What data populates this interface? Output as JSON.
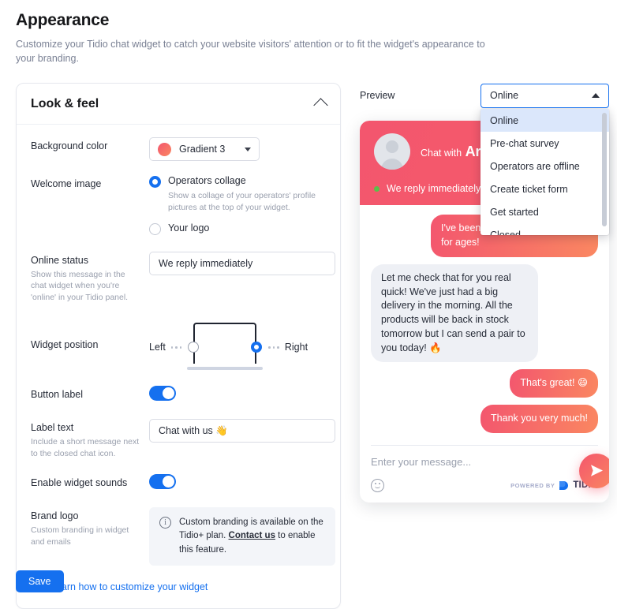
{
  "page": {
    "title": "Appearance",
    "subtitle": "Customize your Tidio chat widget to catch your website visitors' attention or to fit the widget's appearance to your branding."
  },
  "colors": {
    "accent_blue": "#1570ef",
    "gradient_start": "#f3566e",
    "gradient_end": "#fa8761",
    "online_dot": "#5bbf4a"
  },
  "look_feel": {
    "title": "Look & feel",
    "collapse_icon": "chevron-up-icon",
    "background_color": {
      "label": "Background color",
      "value": "Gradient 3",
      "swatch": "gradient-swatch"
    },
    "welcome_image": {
      "label": "Welcome image",
      "options": [
        {
          "label": "Operators collage",
          "description": "Show a collage of your operators' profile pictures at the top of your widget.",
          "selected": true
        },
        {
          "label": "Your logo",
          "description": "",
          "selected": false
        }
      ]
    },
    "online_status": {
      "label": "Online status",
      "sublabel": "Show this message in the chat widget when you're 'online' in your Tidio panel.",
      "value": "We reply immediately",
      "placeholder": "We reply immediately"
    },
    "widget_position": {
      "label": "Widget position",
      "left_label": "Left",
      "right_label": "Right",
      "selected": "Right"
    },
    "button_label": {
      "label": "Button label",
      "enabled": true
    },
    "label_text": {
      "label": "Label text",
      "sublabel": "Include a short message next to the closed chat icon.",
      "value": "Chat with us 👋",
      "placeholder": "Chat with us"
    },
    "widget_sounds": {
      "label": "Enable widget sounds",
      "enabled": true
    },
    "brand_logo": {
      "label": "Brand logo",
      "sublabel": "Custom branding in widget and emails",
      "info_icon": "info-icon",
      "info_text_before": "Custom branding is available on the Tidio+ plan. ",
      "info_link": "Contact us",
      "info_text_after": " to enable this feature."
    },
    "learn_link": {
      "icon": "book-icon",
      "label": "Learn how to customize your widget"
    }
  },
  "preview": {
    "label": "Preview",
    "state_select": {
      "value": "Online",
      "caret_icon": "caret-up-icon",
      "options": [
        {
          "label": "Online",
          "selected": true
        },
        {
          "label": "Pre-chat survey",
          "selected": false
        },
        {
          "label": "Operators are offline",
          "selected": false
        },
        {
          "label": "Create ticket form",
          "selected": false
        },
        {
          "label": "Get started",
          "selected": false
        },
        {
          "label": "Closed",
          "selected": false
        }
      ]
    },
    "widget": {
      "header": {
        "avatar": "avatar-placeholder-icon",
        "greeting_small": "Chat with",
        "greeting_name": "Arek",
        "status_dot": "online-dot-icon",
        "status_text": "We reply immediately"
      },
      "messages": [
        {
          "direction": "out",
          "text": "I've been looking for this model for ages!"
        },
        {
          "direction": "in",
          "text": "Let me check that for you real quick! We've just had a big delivery in the morning. All the products will be back in stock tomorrow but I can send a pair to you today! 🔥"
        },
        {
          "direction": "out",
          "text": "That's great! 😄"
        },
        {
          "direction": "out",
          "text": "Thank you very much!"
        }
      ],
      "footer": {
        "input_placeholder": "Enter your message...",
        "emoji_icon": "smiley-icon",
        "powered_by": "POWERED BY",
        "brand": "TIDIO",
        "send_icon": "send-icon"
      }
    }
  },
  "actions": {
    "save_label": "Save"
  }
}
